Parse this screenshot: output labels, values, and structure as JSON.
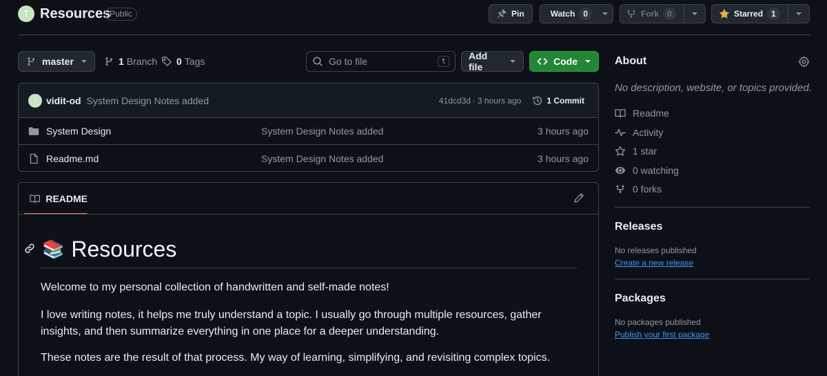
{
  "repo": {
    "name": "Resources",
    "visibility": "Public",
    "avatar_letter": "T"
  },
  "header_actions": {
    "pin_label": "Pin",
    "watch_label": "Watch",
    "watch_count": "0",
    "fork_label": "Fork",
    "fork_count": "0",
    "star_label": "Starred",
    "star_count": "1"
  },
  "toolbar": {
    "branch": "master",
    "branches_count": "1",
    "branches_label": "Branch",
    "tags_count": "0",
    "tags_label": "Tags",
    "search_placeholder": "Go to file",
    "search_shortcut": "t",
    "add_file_label": "Add file",
    "code_label": "Code"
  },
  "latest_commit": {
    "author": "vidit-od",
    "message": "System Design Notes added",
    "hash": "41dcd3d",
    "separator": "·",
    "time": "3 hours ago",
    "commits_label": "1 Commit"
  },
  "files": [
    {
      "name": "System Design",
      "type": "folder",
      "message": "System Design Notes added",
      "time": "3 hours ago"
    },
    {
      "name": "Readme.md",
      "type": "file",
      "message": "System Design Notes added",
      "time": "3 hours ago"
    }
  ],
  "readme": {
    "tab_label": "README",
    "heading_emoji": "📚",
    "heading": "Resources",
    "paragraphs": [
      "Welcome to my personal collection of handwritten and self-made notes!",
      "I love writing notes, it helps me truly understand a topic. I usually go through multiple resources, gather insights, and then summarize everything in one place for a deeper understanding.",
      "These notes are the result of that process. My way of learning, simplifying, and revisiting complex topics."
    ]
  },
  "about": {
    "title": "About",
    "description": "No description, website, or topics provided.",
    "items": [
      "Readme",
      "Activity",
      "1 star",
      "0 watching",
      "0 forks"
    ]
  },
  "releases": {
    "title": "Releases",
    "text": "No releases published",
    "link": "Create a new release"
  },
  "packages": {
    "title": "Packages",
    "text": "No packages published",
    "link": "Publish your first package"
  },
  "colors": {
    "accent_green": "#238636",
    "link_blue": "#4493f8",
    "tab_underline": "#f78166",
    "background": "#0d1117"
  }
}
